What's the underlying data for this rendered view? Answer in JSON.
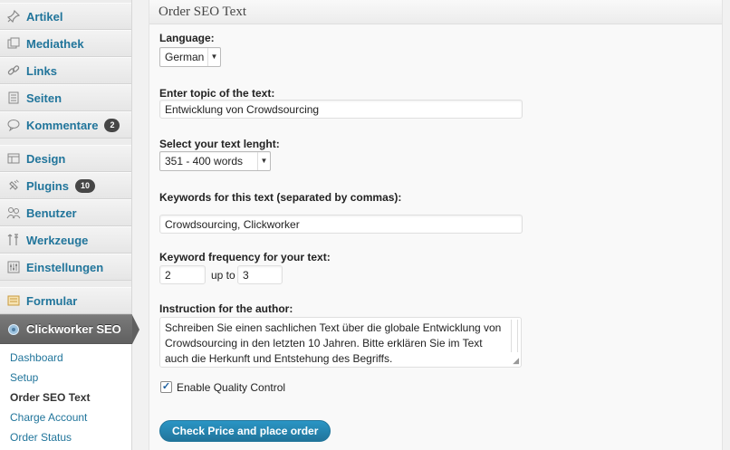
{
  "sidebar": {
    "items": [
      {
        "label": "Artikel",
        "icon": "pin-icon"
      },
      {
        "label": "Mediathek",
        "icon": "media-icon"
      },
      {
        "label": "Links",
        "icon": "link-icon"
      },
      {
        "label": "Seiten",
        "icon": "pages-icon"
      },
      {
        "label": "Kommentare",
        "icon": "comment-icon",
        "badge": "2"
      },
      {
        "label": "Design",
        "icon": "appearance-icon"
      },
      {
        "label": "Plugins",
        "icon": "plugin-icon",
        "badge": "10"
      },
      {
        "label": "Benutzer",
        "icon": "users-icon"
      },
      {
        "label": "Werkzeuge",
        "icon": "tools-icon"
      },
      {
        "label": "Einstellungen",
        "icon": "settings-icon"
      },
      {
        "label": "Formular",
        "icon": "form-icon"
      },
      {
        "label": "Clickworker SEO",
        "icon": "gear-icon"
      }
    ],
    "submenu": [
      {
        "label": "Dashboard"
      },
      {
        "label": "Setup"
      },
      {
        "label": "Order SEO Text"
      },
      {
        "label": "Charge Account"
      },
      {
        "label": "Order Status"
      }
    ]
  },
  "form": {
    "title": "Order SEO Text",
    "language_label": "Language:",
    "language_value": "German",
    "topic_label": "Enter topic of the text:",
    "topic_value": "Entwicklung von Crowdsourcing",
    "length_label": "Select your text lenght:",
    "length_value": "351 - 400 words",
    "keywords_label": "Keywords for this text (separated by commas):",
    "keywords_value": "Crowdsourcing, Clickworker",
    "frequency_label": "Keyword frequency for your text:",
    "frequency_from": "2",
    "frequency_upto": "up to",
    "frequency_to": "3",
    "instruction_label": "Instruction for the author:",
    "instruction_value": "Schreiben Sie einen sachlichen Text über die globale Entwicklung von Crowdsourcing in den letzten 10 Jahren. Bitte erklären Sie im Text auch die Herkunft und Entstehung des Begriffs.",
    "quality_label": "Enable Quality Control",
    "quality_checked": true,
    "submit_label": "Check Price and place order"
  },
  "colors": {
    "link": "#21759b",
    "active_menu": "#606060",
    "button": "#21759b"
  }
}
